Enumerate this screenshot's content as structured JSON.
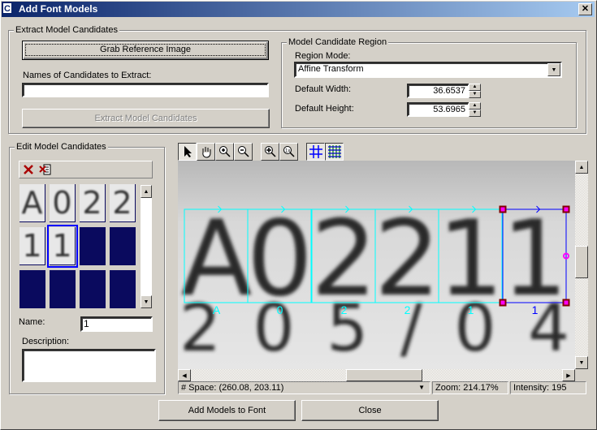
{
  "window": {
    "title": "Add Font Models",
    "icon": "app-icon",
    "close": "✕"
  },
  "extract": {
    "group_label": "Extract Model Candidates",
    "grab_button": "Grab Reference Image",
    "names_label": "Names of Candidates to Extract:",
    "names_value": "",
    "extract_button": "Extract Model Candidates"
  },
  "region": {
    "group_label": "Model Candidate Region",
    "mode_label": "Region Mode:",
    "mode_value": "Affine Transform",
    "width_label": "Default Width:",
    "width_value": "36.6537",
    "height_label": "Default Height:",
    "height_value": "53.6965"
  },
  "edit": {
    "group_label": "Edit Model Candidates",
    "toolbar": [
      "delete-icon",
      "delete-all-icon"
    ],
    "thumbnails": [
      "A",
      "0",
      "2",
      "2",
      "1",
      "1",
      "",
      "",
      "",
      "",
      "",
      ""
    ],
    "selected_index": 5,
    "name_label": "Name:",
    "name_value": "1",
    "description_label": "Description:",
    "description_value": ""
  },
  "viewer": {
    "toolbar": [
      "pointer-icon",
      "pan-hand-icon",
      "zoom-in-icon",
      "zoom-out-icon",
      "zoom-fit-icon",
      "zoom-1x-icon",
      "grid-icon",
      "fine-grid-icon"
    ],
    "candidate_labels": [
      "A",
      "0",
      "2",
      "2",
      "1",
      "1"
    ],
    "top_row_text": [
      "A",
      "0",
      "2",
      "2",
      "1",
      "1"
    ],
    "bottom_row_text": "205/04",
    "colors": {
      "candidate_box": "#00ffff",
      "selected_box": "#0000ff",
      "handle": "#800000"
    }
  },
  "status": {
    "space": "# Space:  (260.08, 203.11)",
    "zoom": "Zoom:  214.17%",
    "intensity": "Intensity: 195"
  },
  "footer": {
    "add_button": "Add Models to Font",
    "close_button": "Close"
  }
}
